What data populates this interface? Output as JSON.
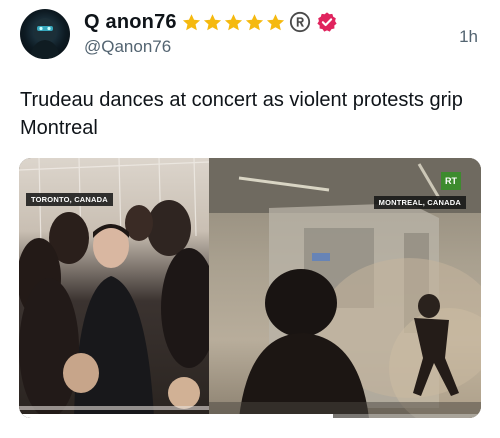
{
  "author": {
    "display_name": "Q anon76",
    "handle": "@Qanon76",
    "star_count": 5,
    "star_color": "#f5b90f",
    "verified_color": "#e0245e",
    "avatar_icon": "masked-figure-avatar"
  },
  "post": {
    "timestamp": "1h",
    "text": "Trudeau dances at concert as violent protests grip Montreal"
  },
  "media": {
    "left_label": "TORONTO, CANADA",
    "right_label": "MONTREAL, CANADA",
    "logo_text": "RT",
    "logo_color": "#3d8b2e",
    "progress": 0.68
  }
}
